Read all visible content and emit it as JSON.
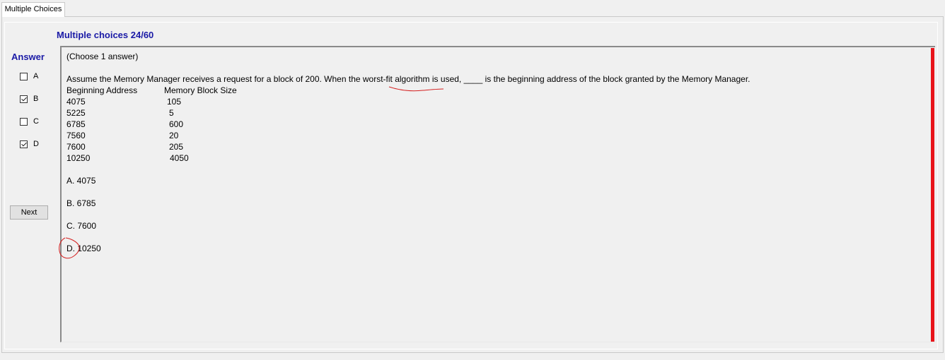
{
  "tab": {
    "label": "Multiple Choices"
  },
  "question_title": "Multiple choices 24/60",
  "answer_panel": {
    "label": "Answer",
    "options": [
      {
        "letter": "A",
        "checked": false
      },
      {
        "letter": "B",
        "checked": true
      },
      {
        "letter": "C",
        "checked": false
      },
      {
        "letter": "D",
        "checked": true
      }
    ],
    "next_label": "Next"
  },
  "question": {
    "instruction": "(Choose 1 answer)",
    "text": "Assume the Memory Manager receives a request for a block of 200. When the worst-fit algorithm is used, ____  is the beginning address of the block granted by the Memory Manager.",
    "table": {
      "headers": [
        "Beginning Address",
        "Memory Block Size"
      ],
      "rows": [
        [
          "4075",
          "105"
        ],
        [
          "5225",
          "5"
        ],
        [
          "6785",
          "600"
        ],
        [
          "7560",
          "20"
        ],
        [
          "7600",
          "205"
        ],
        [
          "10250",
          "4050"
        ]
      ]
    },
    "choices": [
      "A.  4075",
      "B.  6785",
      "C.  7600",
      "D.  10250"
    ]
  },
  "colors": {
    "title_blue": "#1a1aa6",
    "accent_red": "#e8141b",
    "annotation_red": "#d42020"
  }
}
